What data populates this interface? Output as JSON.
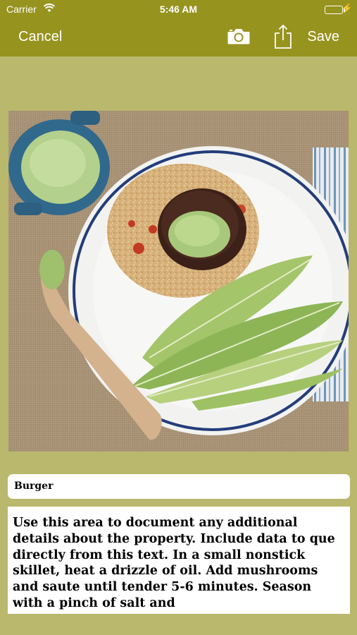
{
  "status_bar": {
    "carrier": "Carrier",
    "time": "5:46 AM"
  },
  "nav": {
    "cancel": "Cancel",
    "save": "Save"
  },
  "colors": {
    "bar": "#97931f",
    "background": "#b9b86c"
  },
  "icons": [
    "camera-icon",
    "share-icon",
    "wifi-icon",
    "battery-icon"
  ],
  "photo": {
    "description_icon": "photo-of-burger-plate"
  },
  "form": {
    "title_value": "Burger",
    "notes_value": "Use this area to document any additional details about the property. Include data to que directly from this text. In a small nonstick skillet, heat a drizzle of oil. Add mushrooms and saute until tender 5-6 minutes. Season with a pinch of salt and"
  }
}
